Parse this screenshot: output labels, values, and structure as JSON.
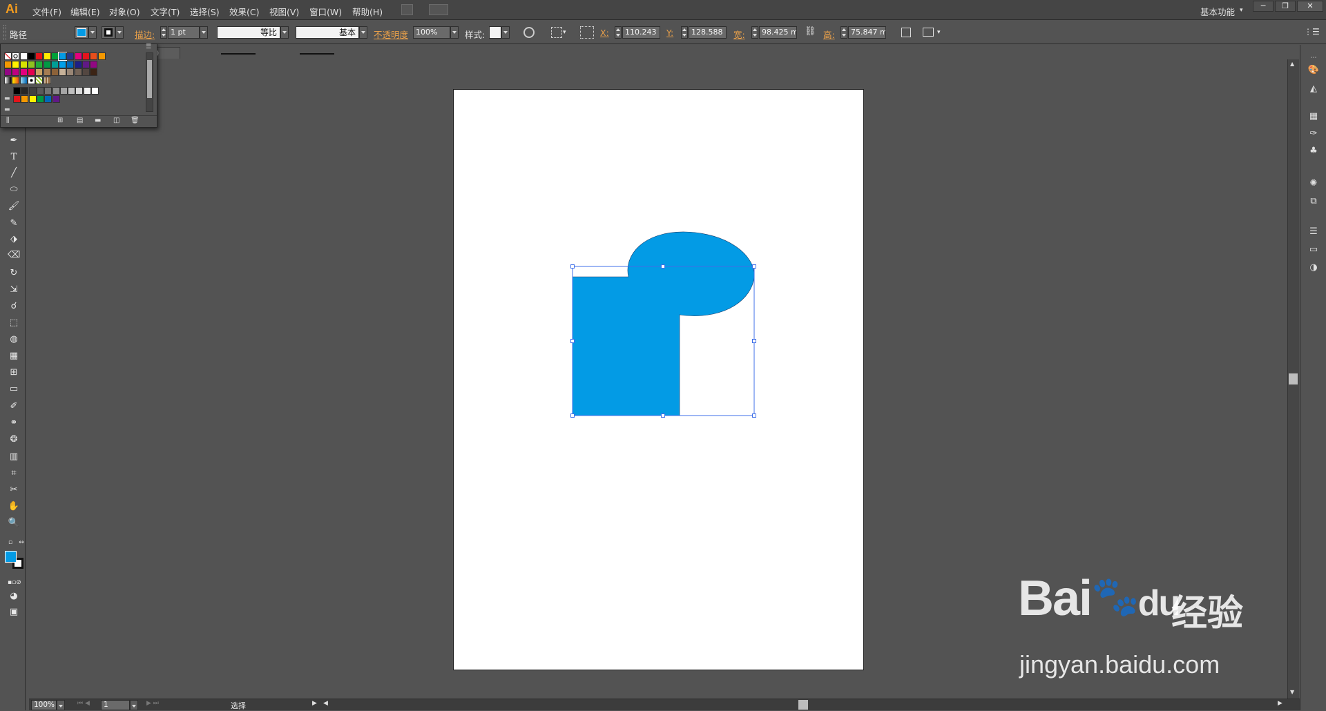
{
  "app": {
    "logo": "Ai"
  },
  "menubar": {
    "items": [
      "文件(F)",
      "编辑(E)",
      "对象(O)",
      "文字(T)",
      "选择(S)",
      "效果(C)",
      "视图(V)",
      "窗口(W)",
      "帮助(H)"
    ],
    "workspace": "基本功能",
    "minimize": "─",
    "restore": "❐",
    "close": "✕"
  },
  "controlbar": {
    "selection_type": "路径",
    "fill_color": "#039be5",
    "stroke_label": "描边:",
    "stroke_weight": "1 pt",
    "stroke_profile": "等比",
    "brush": "基本",
    "opacity_label": "不透明度",
    "opacity": "100%",
    "style_label": "样式:",
    "x_label": "X:",
    "x": "110.243 r",
    "y_label": "Y:",
    "y": "128.588 r",
    "w_label": "宽:",
    "w": "98.425 m",
    "h_label": "高:",
    "h": "75.847 m"
  },
  "document": {
    "tab_suffix": ")",
    "tab_close": "×",
    "shape_fill": "#039be5",
    "selection_color": "#3f6fe8"
  },
  "statusbar": {
    "zoom": "100%",
    "artboard": "1",
    "tool": "选择"
  },
  "swatches": {
    "rows": [
      [
        "none",
        "reg",
        "#ffffff",
        "#000000",
        "#e4141b",
        "#ffec00",
        "#00a139",
        "#039be5",
        "#243684",
        "#e4007f",
        "#e4141b",
        "#e84e1b",
        "#f39800"
      ],
      [
        "#f39800",
        "#fff100",
        "#d7e200",
        "#8fc31f",
        "#22ac38",
        "#009944",
        "#009e96",
        "#00a0e9",
        "#0068b7",
        "#1d2088",
        "#601986",
        "#920783"
      ],
      [
        "#920783",
        "#be0081",
        "#e4007f",
        "#e5004f",
        "#c9a063",
        "#a67c52",
        "#8c6239",
        "#c7b299",
        "#998675",
        "#736357",
        "#534741",
        "#3c2415"
      ],
      [
        "grad1",
        "grad2",
        "grad3",
        "pat1",
        "pat2",
        "pat3"
      ],
      [
        "#000000",
        "#262626",
        "#404040",
        "#595959",
        "#737373",
        "#8c8c8c",
        "#a6a6a6",
        "#bfbfbf",
        "#d9d9d9",
        "#f2f2f2",
        "#ffffff"
      ],
      [
        "#e4141b",
        "#f39800",
        "#fff100",
        "#009944",
        "#0068b7",
        "#601986"
      ]
    ]
  },
  "watermark": {
    "brand": "Bai",
    "brand2": "du",
    "product": "经验",
    "url": "jingyan.baidu.com"
  }
}
